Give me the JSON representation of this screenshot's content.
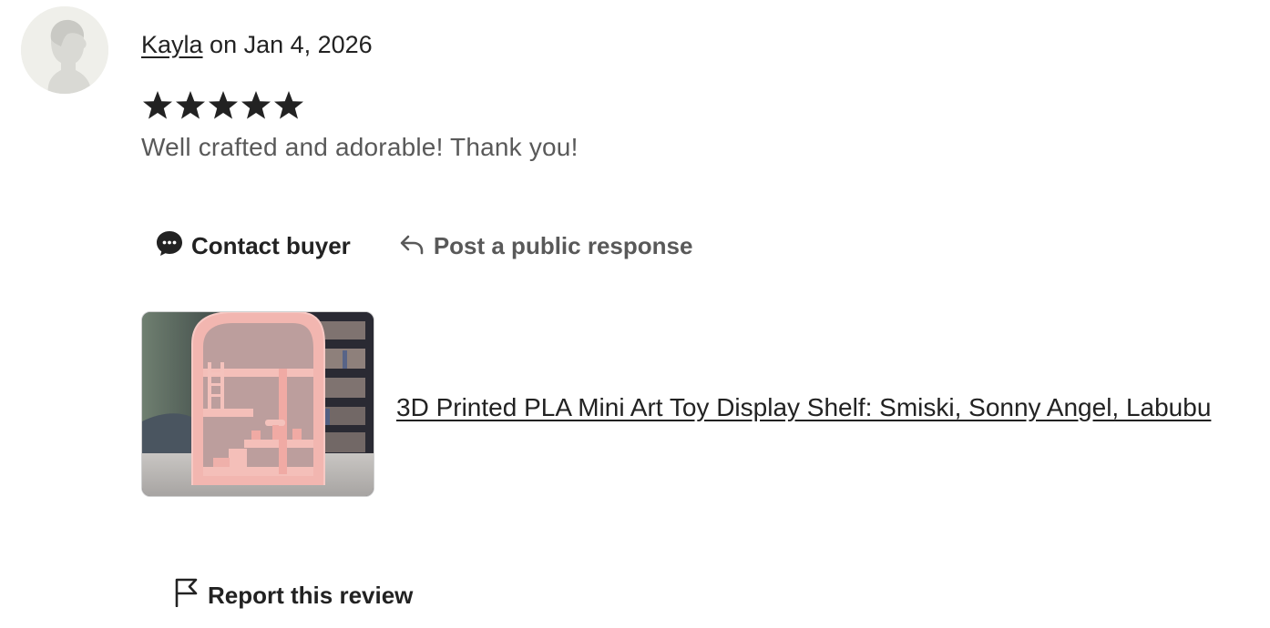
{
  "review": {
    "reviewer_name": "Kayla",
    "date_text": " on Jan 4, 2026",
    "rating": 5,
    "rating_max": 5,
    "text": "Well crafted and adorable! Thank you!"
  },
  "actions": {
    "contact_label": "Contact buyer",
    "contact_icon": "chat-bubble-icon",
    "respond_label": "Post a public response",
    "respond_icon": "reply-arrow-icon"
  },
  "product": {
    "title": "3D Printed PLA Mini Art Toy Display Shelf: Smiski, Sonny Angel, Labubu",
    "thumbnail_icon": "product-photo"
  },
  "report": {
    "label": "Report this review",
    "icon": "flag-icon"
  },
  "colors": {
    "text_primary": "#222222",
    "text_secondary": "#595959",
    "avatar_bg": "#efefea",
    "shelf_pink": "#f2b6b0"
  }
}
